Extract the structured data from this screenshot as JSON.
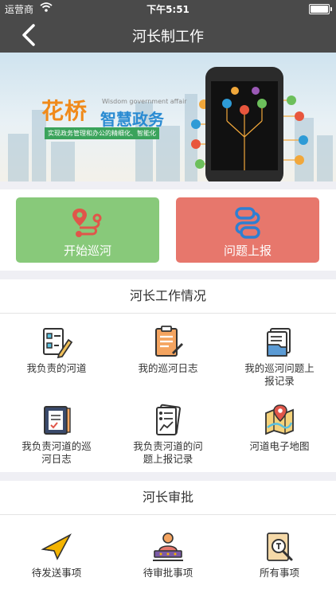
{
  "status_bar": {
    "carrier": "运营商",
    "time": "下午5:51"
  },
  "nav": {
    "title": "河长制工作",
    "back_icon": "chevron-left-icon"
  },
  "banner": {
    "brand_name": "花桥",
    "brand_english": "Wisdom government affair",
    "brand_title": "智慧政务",
    "tagline": "实现政务管理和办公的精细化、智能化"
  },
  "actions": {
    "start_patrol": {
      "label": "开始巡河",
      "icon": "map-route-icon",
      "color": "#88c97a"
    },
    "report_issue": {
      "label": "问题上报",
      "icon": "link-report-icon",
      "color": "#e7776c"
    }
  },
  "work_section": {
    "title": "河长工作情况",
    "items": [
      {
        "label": "我负责的河道",
        "icon": "checklist-pen-icon"
      },
      {
        "label": "我的巡河日志",
        "icon": "clipboard-notes-icon"
      },
      {
        "label": "我的巡河问题上报记录",
        "icon": "folder-documents-icon"
      },
      {
        "label": "我负责河道的巡河日志",
        "icon": "notebook-log-icon"
      },
      {
        "label": "我负责河道的问题上报记录",
        "icon": "report-chart-icon"
      },
      {
        "label": "河道电子地图",
        "icon": "map-pin-icon"
      }
    ]
  },
  "approval_section": {
    "title": "河长审批",
    "items": [
      {
        "label": "待发送事项",
        "icon": "paper-plane-icon"
      },
      {
        "label": "待审批事项",
        "icon": "approver-stamp-icon"
      },
      {
        "label": "所有事项",
        "icon": "document-search-icon"
      }
    ]
  }
}
